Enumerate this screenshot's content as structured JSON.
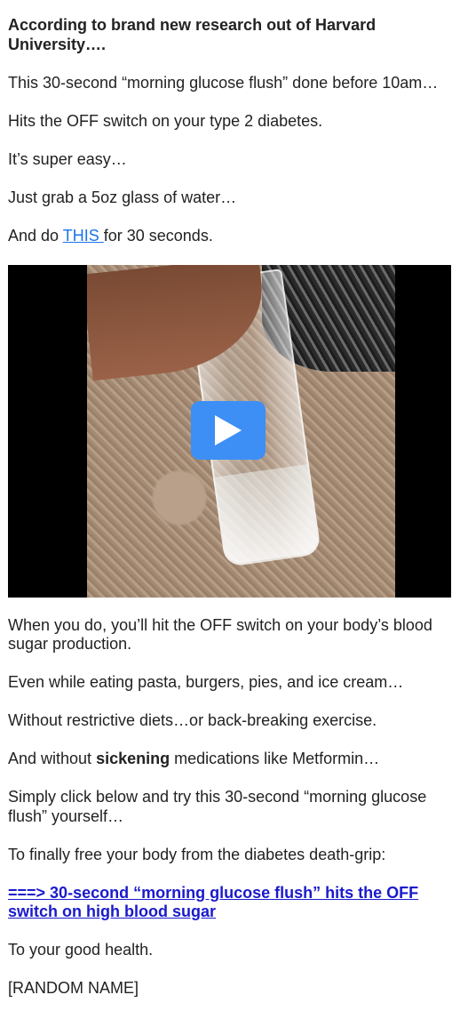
{
  "intro": {
    "headline": "According to brand new research out of Harvard University….",
    "p1": "This 30-second “morning glucose flush” done before 10am…",
    "p2": "Hits the OFF switch on your type 2 diabetes.",
    "p3": "It’s super easy…",
    "p4": "Just grab a 5oz glass of water…",
    "p5_before": "And do ",
    "p5_link": "THIS ",
    "p5_after": "for 30 seconds."
  },
  "video": {
    "play_icon": "play-icon",
    "accent_color": "#3d8ff5"
  },
  "body": {
    "p6": "When you do, you’ll hit the OFF switch on your body’s blood sugar production.",
    "p7": "Even while eating pasta, burgers, pies, and ice cream…",
    "p8": "Without restrictive diets…or back-breaking exercise.",
    "p9_before": "And without ",
    "p9_bold": "sickening",
    "p9_after": " medications like Metformin…",
    "p10": "Simply click below and try this 30-second “morning glucose flush” yourself…",
    "p11": "To finally free your body from the diabetes death-grip:",
    "cta": "===> 30-second “morning glucose flush” hits the OFF switch on high blood sugar",
    "p12": "To your good health.",
    "signature": "[RANDOM NAME]"
  },
  "colors": {
    "text": "#222222",
    "inline_link": "#1a73e8",
    "cta_link": "#1a1acc"
  }
}
